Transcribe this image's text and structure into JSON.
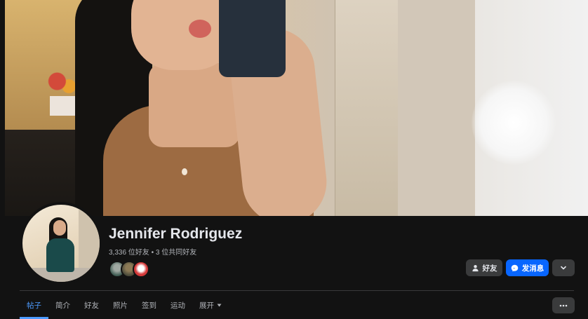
{
  "profile": {
    "name": "Jennifer Rodriguez",
    "friends_count": "3,336 位好友",
    "mutual_friends": "3 位共同好友",
    "separator": "•"
  },
  "actions": {
    "friends_label": "好友",
    "message_label": "发消息"
  },
  "tabs": [
    {
      "label": "帖子"
    },
    {
      "label": "简介"
    },
    {
      "label": "好友"
    },
    {
      "label": "照片"
    },
    {
      "label": "签到"
    },
    {
      "label": "运动"
    },
    {
      "label": "展开"
    }
  ],
  "colors": {
    "background": "#121212",
    "accent": "#0866ff",
    "active_tab": "#4d9bff",
    "button_gray": "#3a3b3c"
  },
  "icons": {
    "friends_button": "person-check-icon",
    "message_button": "messenger-icon",
    "chevron": "chevron-down-icon",
    "more": "more-dots-icon"
  }
}
